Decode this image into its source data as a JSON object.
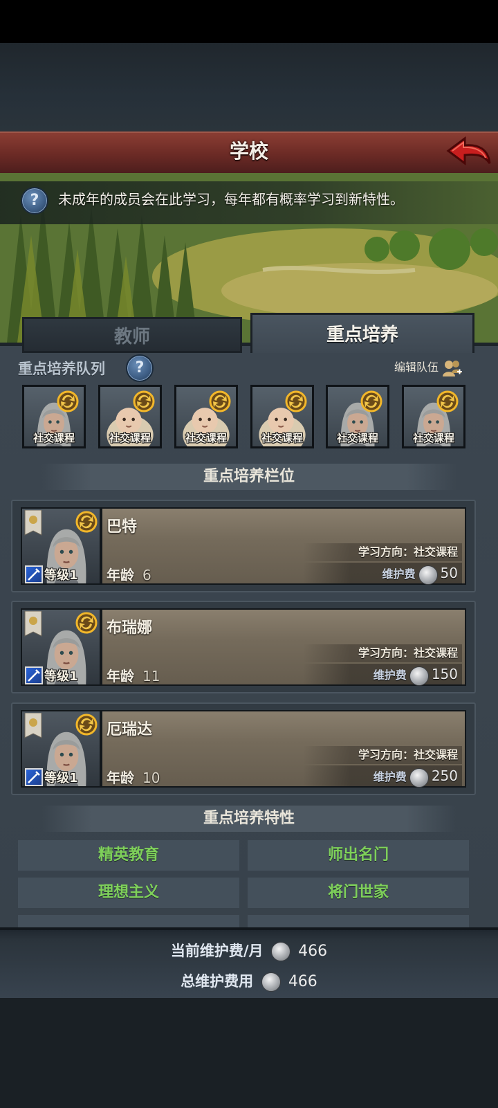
{
  "header": {
    "title": "学校"
  },
  "info": {
    "text": "未成年的成员会在此学习，每年都有概率学习到新特性。"
  },
  "tabs": [
    {
      "label": "教师",
      "active": false
    },
    {
      "label": "重点培养",
      "active": true
    }
  ],
  "queue": {
    "label": "重点培养队列",
    "edit_label": "编辑队伍",
    "slots": [
      {
        "label": "社交课程",
        "portrait": "grey-hair-child"
      },
      {
        "label": "社交课程",
        "portrait": "baby"
      },
      {
        "label": "社交课程",
        "portrait": "baby"
      },
      {
        "label": "社交课程",
        "portrait": "baby"
      },
      {
        "label": "社交课程",
        "portrait": "grey-hair-child"
      },
      {
        "label": "社交课程",
        "portrait": "grey-hair-child"
      }
    ]
  },
  "slots_section": {
    "title": "重点培养栏位"
  },
  "students": [
    {
      "name": "巴特",
      "level": "等级1",
      "age_label": "年龄",
      "age": "6",
      "study": "学习方向：社交课程",
      "upkeep_label": "维护费",
      "upkeep": "50"
    },
    {
      "name": "布瑞娜",
      "level": "等级1",
      "age_label": "年龄",
      "age": "11",
      "study": "学习方向：社交课程",
      "upkeep_label": "维护费",
      "upkeep": "150"
    },
    {
      "name": "厄瑞达",
      "level": "等级1",
      "age_label": "年龄",
      "age": "10",
      "study": "学习方向：社交课程",
      "upkeep_label": "维护费",
      "upkeep": "250"
    }
  ],
  "traits_section": {
    "title": "重点培养特性",
    "items": [
      "精英教育",
      "师出名门",
      "理想主义",
      "将门世家"
    ]
  },
  "footer": {
    "monthly_label": "当前维护费/月",
    "monthly_value": "466",
    "total_label": "总维护费用",
    "total_value": "466"
  },
  "colors": {
    "title_bar": "#6b2a25",
    "trait_text": "#7ed05a",
    "panel": "#3c4650"
  }
}
